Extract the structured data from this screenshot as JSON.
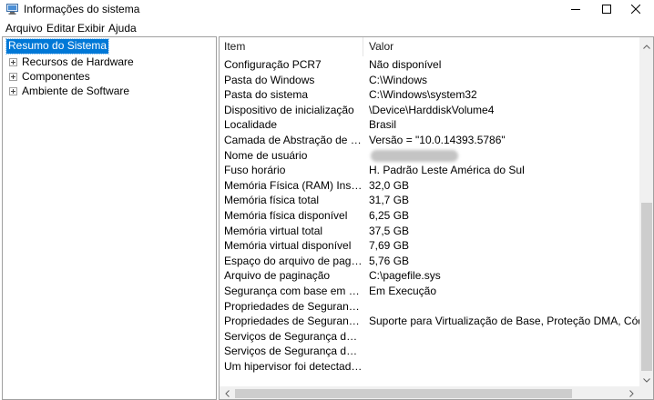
{
  "window": {
    "title": "Informações do sistema",
    "icon": "system-info-icon"
  },
  "menu": [
    {
      "label": "Arquivo"
    },
    {
      "label": "Editar"
    },
    {
      "label": "Exibir"
    },
    {
      "label": "Ajuda"
    }
  ],
  "tree": {
    "root": "Resumo do Sistema",
    "children": [
      {
        "label": "Recursos de Hardware"
      },
      {
        "label": "Componentes"
      },
      {
        "label": "Ambiente de Software"
      }
    ]
  },
  "table": {
    "headers": {
      "item": "Item",
      "value": "Valor"
    },
    "rows": [
      {
        "item": "Configuração PCR7",
        "value": "Não disponível"
      },
      {
        "item": "Pasta do Windows",
        "value": "C:\\Windows"
      },
      {
        "item": "Pasta do sistema",
        "value": "C:\\Windows\\system32"
      },
      {
        "item": "Dispositivo de inicialização",
        "value": "\\Device\\HarddiskVolume4"
      },
      {
        "item": "Localidade",
        "value": "Brasil"
      },
      {
        "item": "Camada de Abstração de Hard...",
        "value": "Versão = \"10.0.14393.5786\""
      },
      {
        "item": "Nome de usuário",
        "value": "",
        "redacted": true
      },
      {
        "item": "Fuso horário",
        "value": "H. Padrão Leste América do Sul"
      },
      {
        "item": "Memória Física (RAM) Instalada",
        "value": "32,0 GB"
      },
      {
        "item": "Memória física total",
        "value": "31,7 GB"
      },
      {
        "item": "Memória física disponível",
        "value": "6,25 GB"
      },
      {
        "item": "Memória virtual total",
        "value": "37,5 GB"
      },
      {
        "item": "Memória virtual disponível",
        "value": "7,69 GB"
      },
      {
        "item": "Espaço do arquivo de paginaç...",
        "value": "5,76 GB"
      },
      {
        "item": "Arquivo de paginação",
        "value": "C:\\pagefile.sys"
      },
      {
        "item": "Segurança com base em Virtua...",
        "value": "Em Execução"
      },
      {
        "item": "Propriedades de Segurança O...",
        "value": ""
      },
      {
        "item": "Propriedades de Segurança Di...",
        "value": "Suporte para Virtualização de Base, Proteção DMA, Código UEFI"
      },
      {
        "item": "Serviços de Segurança da Prot...",
        "value": ""
      },
      {
        "item": "Serviços de Segurança da Prot...",
        "value": ""
      },
      {
        "item": "Um hipervisor foi detectado. R...",
        "value": ""
      }
    ]
  },
  "colors": {
    "selection": "#0078d7",
    "border": "#a0a0a0",
    "scrollbar_track": "#f0f0f0",
    "scrollbar_thumb": "#cdcdcd"
  }
}
